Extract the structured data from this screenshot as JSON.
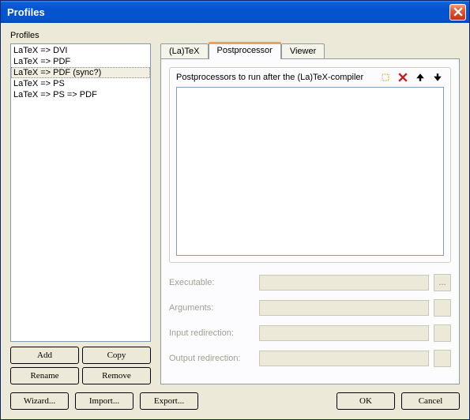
{
  "window": {
    "title": "Profiles"
  },
  "left": {
    "label": "Profiles",
    "items": [
      "LaTeX => DVI",
      "LaTeX => PDF",
      "LaTeX => PDF (sync?)",
      "LaTeX => PS",
      "LaTeX => PS => PDF"
    ],
    "selected_index": 2,
    "buttons": {
      "add": "Add",
      "copy": "Copy",
      "rename": "Rename",
      "remove": "Remove"
    }
  },
  "tabs": {
    "items": [
      "(La)TeX",
      "Postprocessor",
      "Viewer"
    ],
    "active_index": 1
  },
  "groupbox": {
    "label": "Postprocessors to run after the (La)TeX-compiler"
  },
  "form": {
    "executable": {
      "label": "Executable:",
      "value": "",
      "browse": "..."
    },
    "arguments": {
      "label": "Arguments:",
      "value": ""
    },
    "input_redir": {
      "label": "Input redirection:",
      "value": ""
    },
    "output_redir": {
      "label": "Output redirection:",
      "value": ""
    }
  },
  "bottom": {
    "wizard": "Wizard...",
    "import": "Import...",
    "export": "Export...",
    "ok": "OK",
    "cancel": "Cancel"
  }
}
